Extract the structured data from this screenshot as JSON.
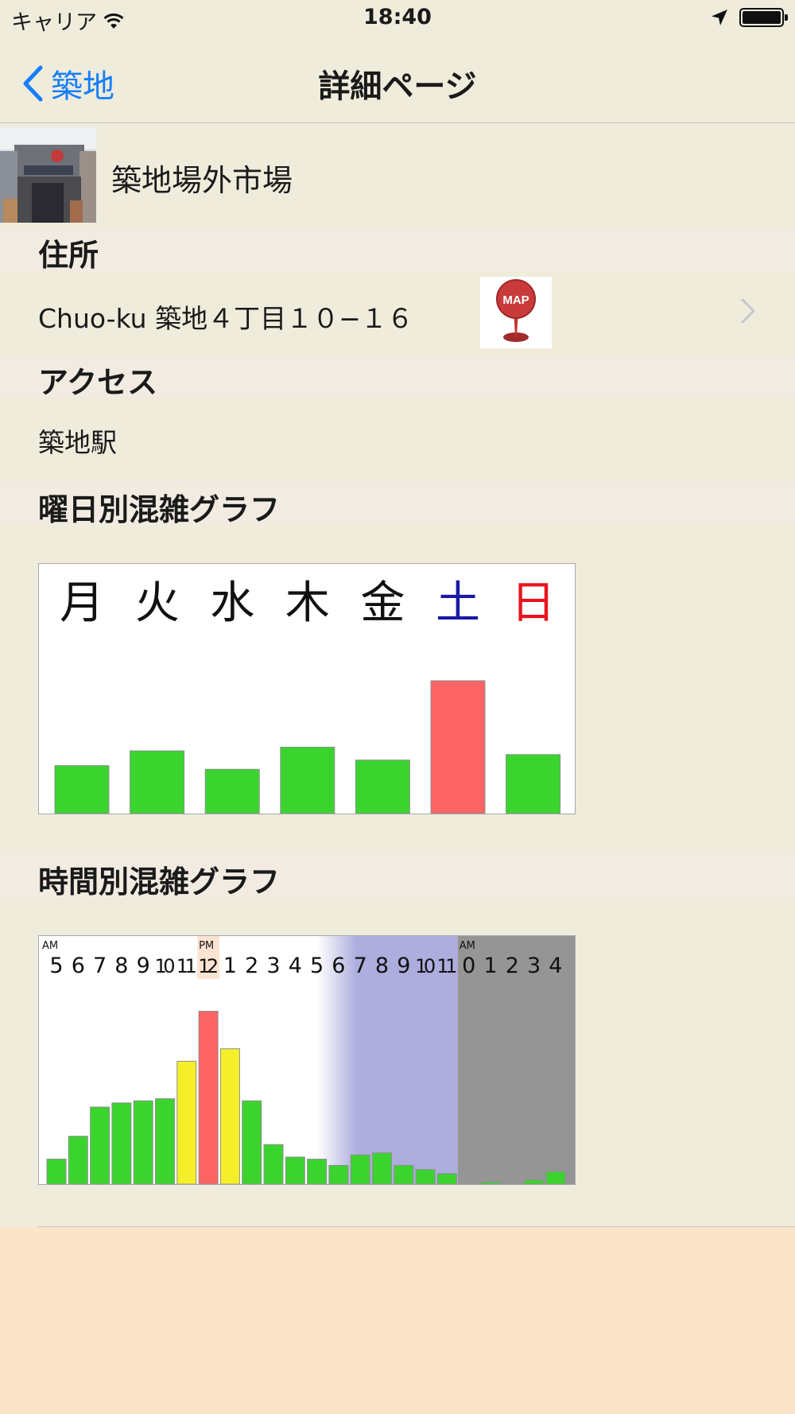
{
  "status_bar": {
    "carrier": "キャリア",
    "time": "18:40",
    "icons": [
      "wifi-icon",
      "location-arrow-icon",
      "battery-icon"
    ]
  },
  "nav": {
    "back_label": "築地",
    "title": "詳細ページ"
  },
  "place": {
    "name": "築地場外市場"
  },
  "sections": {
    "address_header": "住所",
    "access_header": "アクセス",
    "weekday_header": "曜日別混雑グラフ",
    "hourly_header": "時間別混雑グラフ"
  },
  "address": {
    "text": "Chuo-ku 築地４丁目１０−１６",
    "map_icon_label": "MAP"
  },
  "access": {
    "text": "築地駅"
  },
  "colors": {
    "accent": "#157efb",
    "bar_normal": "#3bd42f",
    "bar_busy": "#fe6464",
    "bar_medium": "#f5ef2a",
    "saturday": "#1a1aa6",
    "sunday": "#e8141e",
    "evening": "#adadde",
    "night": "#959595",
    "background": "#efecdc",
    "footer": "#fbe4c9"
  },
  "chart_data": [
    {
      "type": "bar",
      "categories": [
        "月",
        "火",
        "水",
        "木",
        "金",
        "土",
        "日"
      ],
      "values": [
        26,
        34,
        24,
        36,
        29,
        72,
        32
      ],
      "ylim": [
        0,
        100
      ]
    },
    {
      "type": "bar",
      "period_labels": [
        "AM",
        "PM",
        "AM"
      ],
      "categories": [
        "5",
        "6",
        "7",
        "8",
        "9",
        "10",
        "11",
        "12",
        "1",
        "2",
        "3",
        "4",
        "5",
        "6",
        "7",
        "8",
        "9",
        "10",
        "11",
        "0",
        "1",
        "2",
        "3",
        "4"
      ],
      "values": [
        12,
        23,
        37,
        39,
        40,
        41,
        59,
        83,
        65,
        40,
        19,
        13,
        12,
        9,
        14,
        15,
        9,
        7,
        5,
        0,
        1,
        0,
        2,
        6
      ],
      "ylim": [
        0,
        100
      ]
    }
  ]
}
